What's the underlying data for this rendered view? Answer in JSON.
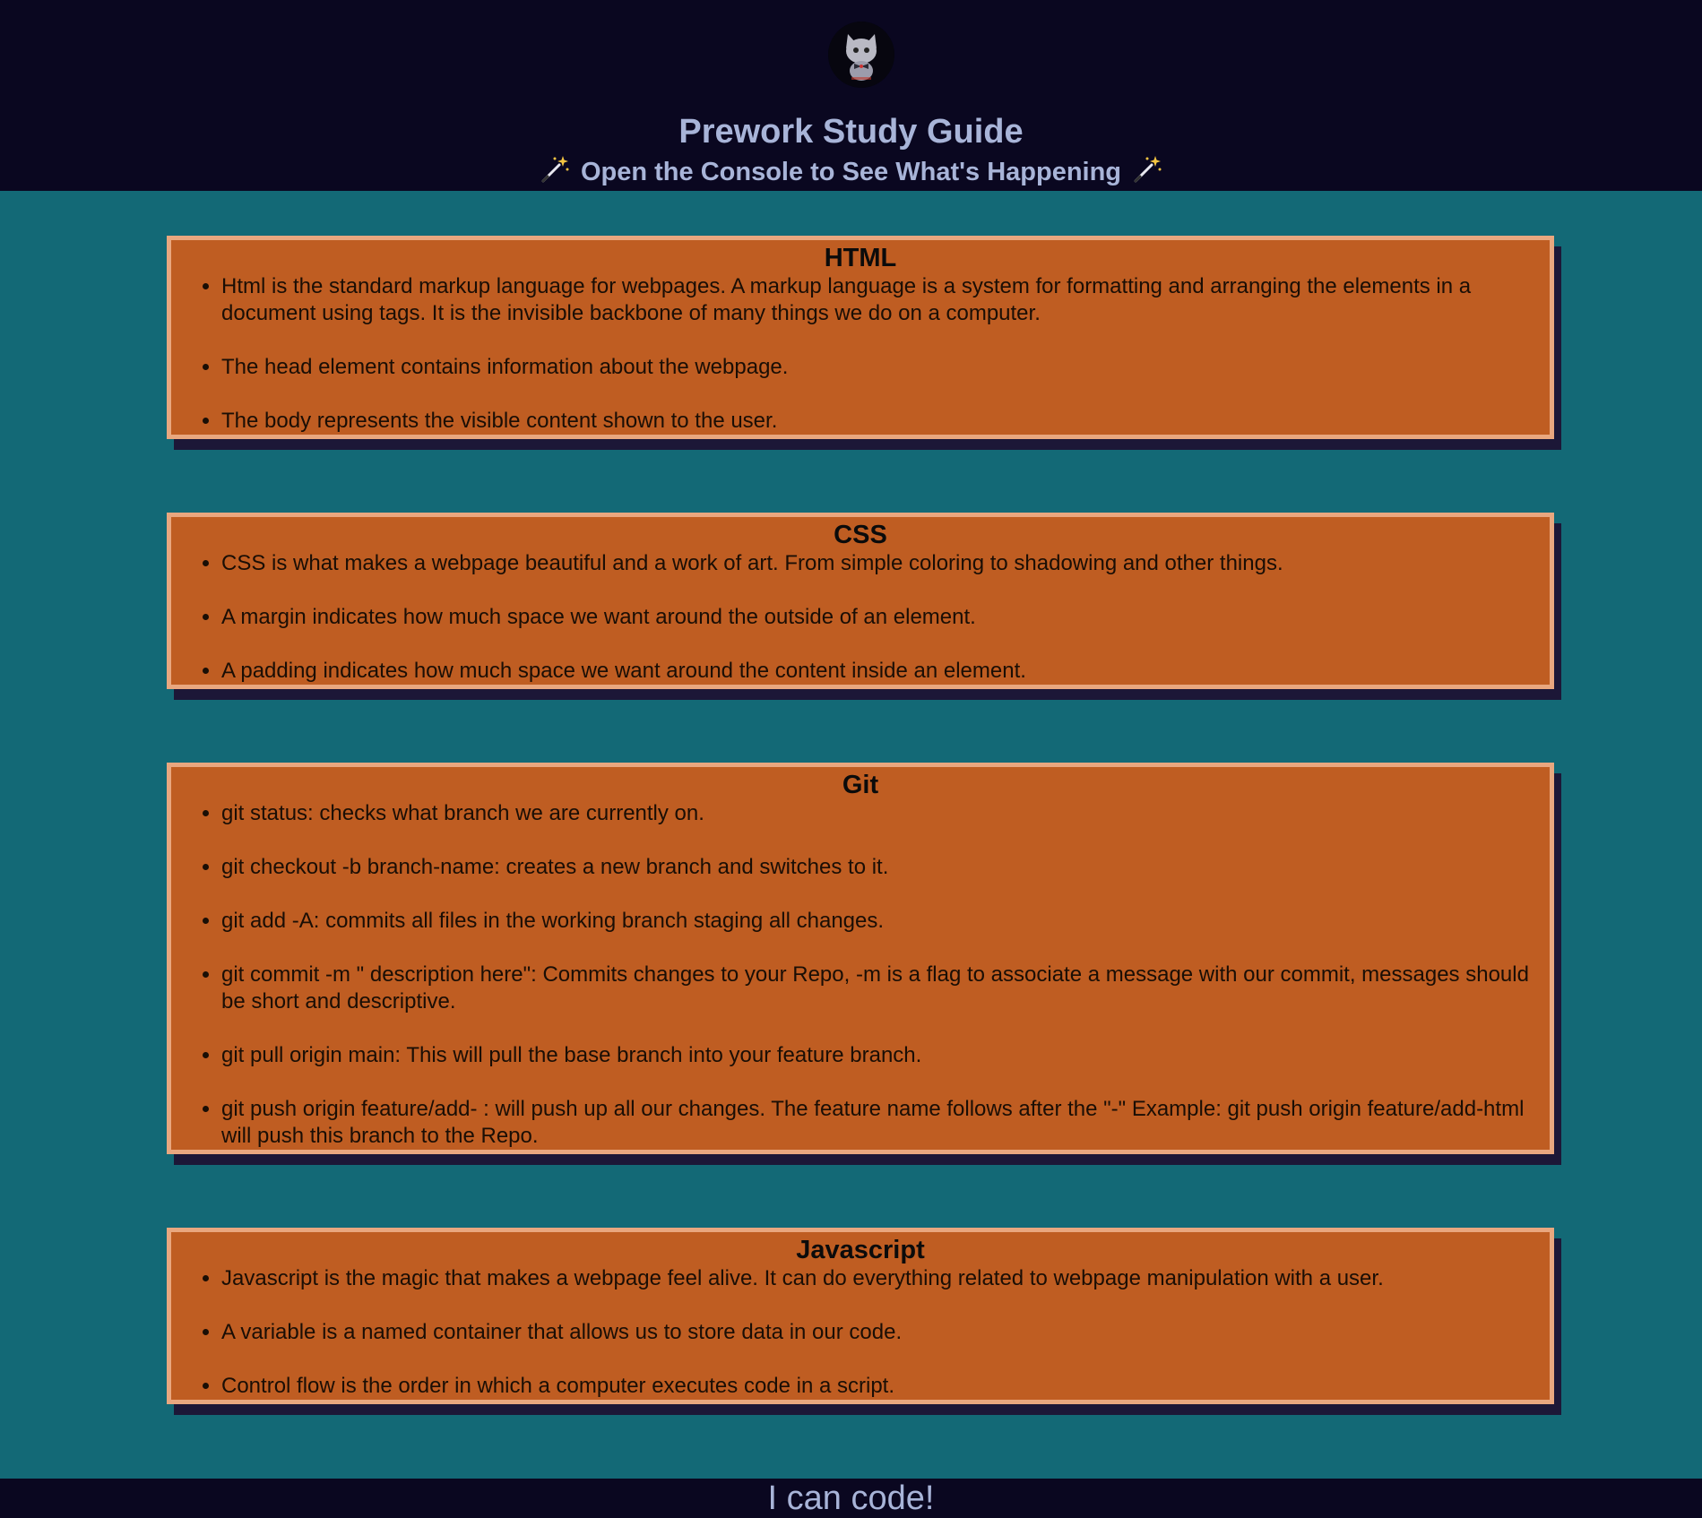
{
  "header": {
    "title": "Prework Study Guide",
    "subtitle": "Open the Console to See What's Happening",
    "logo_icon": "cat-avatar-icon",
    "decoration_icon": "magic-wand-icon"
  },
  "sections": [
    {
      "title": "HTML",
      "items": [
        "Html is the standard markup language for webpages. A markup language is a system for formatting and arranging the elements in a document using tags. It is the invisible backbone of many things we do on a computer.",
        "The head element contains information about the webpage.",
        "The body represents the visible content shown to the user."
      ]
    },
    {
      "title": "CSS",
      "items": [
        "CSS is what makes a webpage beautiful and a work of art. From simple coloring to shadowing and other things.",
        "A margin indicates how much space we want around the outside of an element.",
        "A padding indicates how much space we want around the content inside an element."
      ]
    },
    {
      "title": "Git",
      "items": [
        "git status: checks what branch we are currently on.",
        "git checkout -b branch-name: creates a new branch and switches to it.",
        "git add -A: commits all files in the working branch staging all changes.",
        "git commit -m \" description here\": Commits changes to your Repo, -m is a flag to associate a message with our commit, messages should be short and descriptive.",
        "git pull origin main: This will pull the base branch into your feature branch.",
        "git push origin feature/add- : will push up all our changes. The feature name follows after the \"-\" Example: git push origin feature/add-html will push this branch to the Repo."
      ]
    },
    {
      "title": "Javascript",
      "items": [
        "Javascript is the magic that makes a webpage feel alive. It can do everything related to webpage manipulation with a user.",
        "A variable is a named container that allows us to store data in our code.",
        "Control flow is the order in which a computer executes code in a script."
      ]
    }
  ],
  "footer": {
    "text": "I can code!"
  },
  "colors": {
    "header_bg": "#0a0720",
    "page_bg": "#136976",
    "card_bg": "#bf5d22",
    "card_border": "#e9a77f",
    "card_shadow": "#1c1737",
    "heading_text": "#a8b4d8"
  }
}
